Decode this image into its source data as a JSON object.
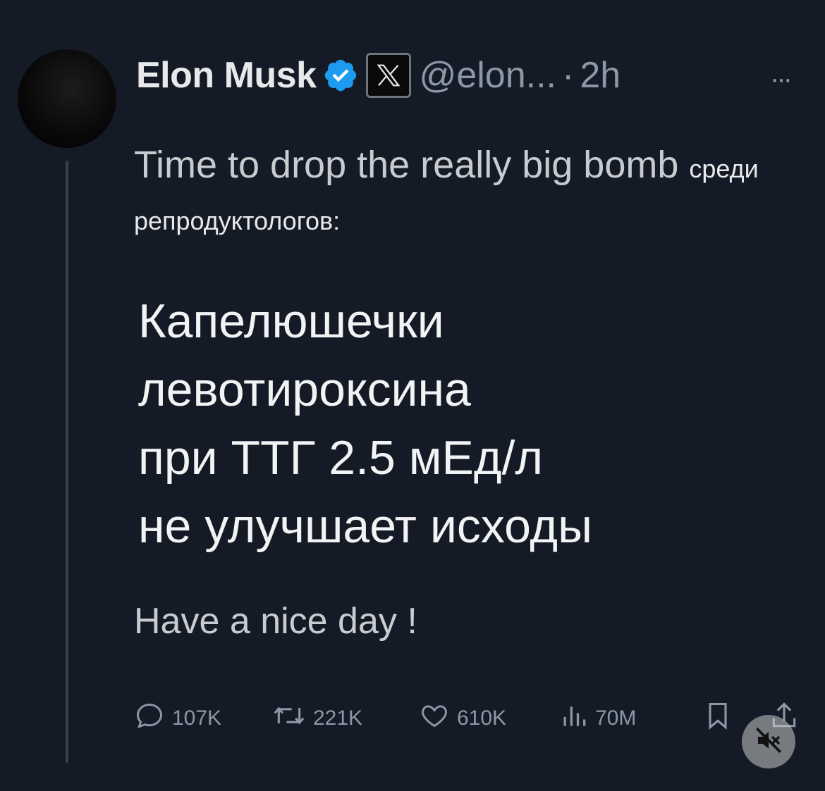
{
  "tweet": {
    "author_name": "Elon Musk",
    "handle": "@elon...",
    "separator": "·",
    "time": "2h",
    "more": "···",
    "intro_en": "Time to drop the really big bomb",
    "intro_ru": "среди репродуктологов:",
    "main_lines": [
      "Капелюшечки",
      "левотироксина",
      "при ТТГ 2.5 мЕд/л",
      "не улучшает исходы"
    ],
    "outro": "Have a nice day !"
  },
  "actions": {
    "replies": "107K",
    "reposts": "221K",
    "likes": "610K",
    "views": "70M"
  },
  "icons": {
    "verified": "verified-badge-icon",
    "x_logo": "x-logo-icon",
    "more": "more-options-icon",
    "reply": "reply-icon",
    "repost": "repost-icon",
    "like": "heart-icon",
    "views": "views-icon",
    "bookmark": "bookmark-icon",
    "share": "share-icon",
    "mute": "muted-speaker-icon"
  },
  "colors": {
    "background": "#151b26",
    "verified_blue": "#1d9bf0",
    "muted_text": "#8b98a5"
  }
}
